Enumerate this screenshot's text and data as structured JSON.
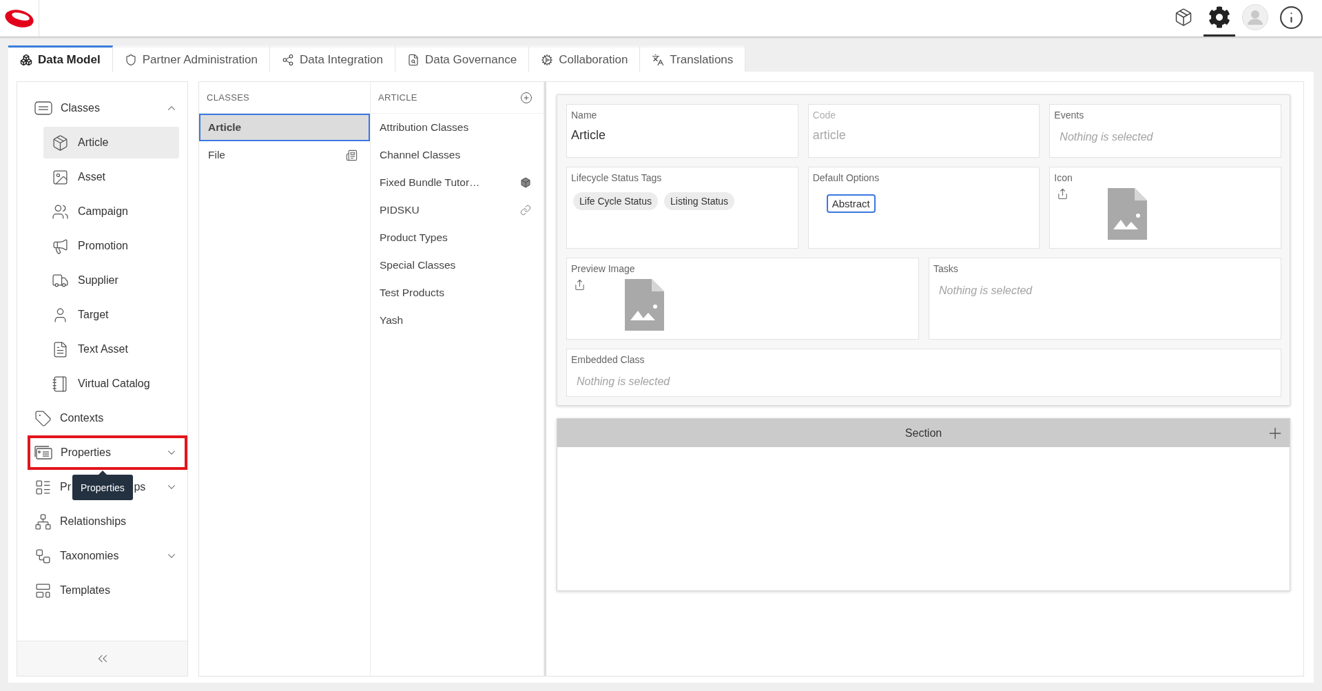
{
  "top_actions": [
    {
      "kind": "catalog",
      "selected": false
    },
    {
      "kind": "settings",
      "selected": true
    },
    {
      "kind": "profile",
      "selected": false
    },
    {
      "kind": "info",
      "selected": false
    }
  ],
  "tabs": [
    {
      "kind": "data-model",
      "label": "Data Model",
      "selected": true
    },
    {
      "kind": "partner",
      "label": "Partner Administration",
      "selected": false
    },
    {
      "kind": "integration",
      "label": "Data Integration",
      "selected": false
    },
    {
      "kind": "governance",
      "label": "Data Governance",
      "selected": false
    },
    {
      "kind": "collaboration",
      "label": "Collaboration",
      "selected": false
    },
    {
      "kind": "translations",
      "label": "Translations",
      "selected": false
    }
  ],
  "sidebar": {
    "items": [
      {
        "kind": "classes",
        "label": "Classes",
        "selected": false,
        "highlighted": false,
        "expanded": true,
        "children": [
          {
            "kind": "article",
            "label": "Article",
            "selected": true
          },
          {
            "kind": "asset",
            "label": "Asset",
            "selected": false
          },
          {
            "kind": "campaign",
            "label": "Campaign",
            "selected": false
          },
          {
            "kind": "promotion",
            "label": "Promotion",
            "selected": false
          },
          {
            "kind": "supplier",
            "label": "Supplier",
            "selected": false
          },
          {
            "kind": "target",
            "label": "Target",
            "selected": false
          },
          {
            "kind": "text-asset",
            "label": "Text Asset",
            "selected": false
          },
          {
            "kind": "virtual-catalog",
            "label": "Virtual Catalog",
            "selected": false
          }
        ]
      },
      {
        "kind": "contexts",
        "label": "Contexts",
        "selected": false,
        "highlighted": false
      },
      {
        "kind": "properties",
        "label": "Properties",
        "selected": false,
        "highlighted": true,
        "expanded": false
      },
      {
        "kind": "property-groups",
        "label_parts": [
          "Pr",
          "ps"
        ],
        "selected": false,
        "highlighted": false,
        "expanded": false
      },
      {
        "kind": "relationships",
        "label": "Relationships",
        "selected": false,
        "highlighted": false
      },
      {
        "kind": "taxonomies",
        "label": "Taxonomies",
        "selected": false,
        "highlighted": false,
        "expanded": false
      },
      {
        "kind": "templates",
        "label": "Templates",
        "selected": false,
        "highlighted": false
      }
    ],
    "tooltip": "Properties"
  },
  "classes_column": {
    "heading": "CLASSES",
    "items": [
      {
        "kind": "plain",
        "label": "Article",
        "selected": true
      },
      {
        "kind": "document",
        "label": "File",
        "selected": false
      }
    ]
  },
  "article_column": {
    "heading": "ARTICLE",
    "items": [
      {
        "kind": "plain",
        "label": "Attribution Classes"
      },
      {
        "kind": "plain",
        "label": "Channel Classes"
      },
      {
        "kind": "bundle",
        "label": "Fixed Bundle Tutor…"
      },
      {
        "kind": "link",
        "label": "PIDSKU"
      },
      {
        "kind": "plain",
        "label": "Product Types"
      },
      {
        "kind": "plain",
        "label": "Special Classes"
      },
      {
        "kind": "plain",
        "label": "Test Products"
      },
      {
        "kind": "plain",
        "label": "Yash"
      }
    ]
  },
  "form": {
    "rows": [
      [
        {
          "kind": "text",
          "label": "Name",
          "value": "Article",
          "disabled": false
        },
        {
          "kind": "text",
          "label": "Code",
          "value": "article",
          "disabled": true
        },
        {
          "kind": "select",
          "label": "Events",
          "placeholder": "Nothing is selected"
        }
      ],
      [
        {
          "kind": "tags",
          "label": "Lifecycle Status Tags",
          "tags": [
            "Life Cycle Status",
            "Listing Status"
          ]
        },
        {
          "kind": "options",
          "label": "Default Options",
          "options": [
            {
              "label": "Abstract",
              "selected": true
            }
          ]
        },
        {
          "kind": "image",
          "label": "Icon"
        }
      ],
      [
        {
          "kind": "image",
          "label": "Preview Image"
        },
        {
          "kind": "select",
          "label": "Tasks",
          "placeholder": "Nothing is selected"
        }
      ],
      [
        {
          "kind": "select",
          "label": "Embedded Class",
          "placeholder": "Nothing is selected"
        }
      ]
    ]
  },
  "section": {
    "title": "Section"
  }
}
